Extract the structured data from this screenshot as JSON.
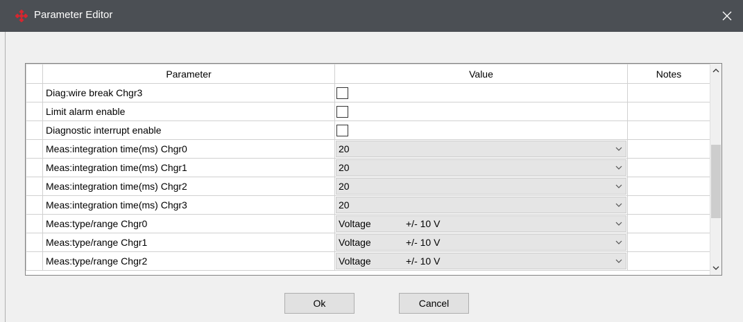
{
  "window": {
    "title": "Parameter Editor"
  },
  "grid": {
    "columns": {
      "parameter": "Parameter",
      "value": "Value",
      "notes": "Notes"
    },
    "rows": [
      {
        "parameter": "Diag:wire break Chgr3",
        "type": "checkbox"
      },
      {
        "parameter": "Limit alarm enable",
        "type": "checkbox"
      },
      {
        "parameter": "Diagnostic interrupt enable",
        "type": "checkbox"
      },
      {
        "parameter": "Meas:integration time(ms) Chgr0",
        "type": "combo",
        "value": "20"
      },
      {
        "parameter": "Meas:integration time(ms) Chgr1",
        "type": "combo",
        "value": "20"
      },
      {
        "parameter": "Meas:integration time(ms) Chgr2",
        "type": "combo",
        "value": "20"
      },
      {
        "parameter": "Meas:integration time(ms) Chgr3",
        "type": "combo",
        "value": "20"
      },
      {
        "parameter": "Meas:type/range Chgr0",
        "type": "combo",
        "value": "Voltage",
        "value2": "+/- 10 V"
      },
      {
        "parameter": "Meas:type/range Chgr1",
        "type": "combo",
        "value": "Voltage",
        "value2": "+/- 10 V"
      },
      {
        "parameter": "Meas:type/range Chgr2",
        "type": "combo",
        "value": "Voltage",
        "value2": "+/- 10 V"
      }
    ]
  },
  "buttons": {
    "ok": "Ok",
    "cancel": "Cancel"
  },
  "icons": {
    "logo": "app-logo-icon",
    "close": "close-icon",
    "dropdown": "chevron-down-icon",
    "scroll_up": "chevron-up-icon",
    "scroll_down": "chevron-down-icon"
  },
  "colors": {
    "titlebar": "#4b4f54",
    "logo": "#d6262f",
    "combo_bg": "#e5e5e5"
  }
}
